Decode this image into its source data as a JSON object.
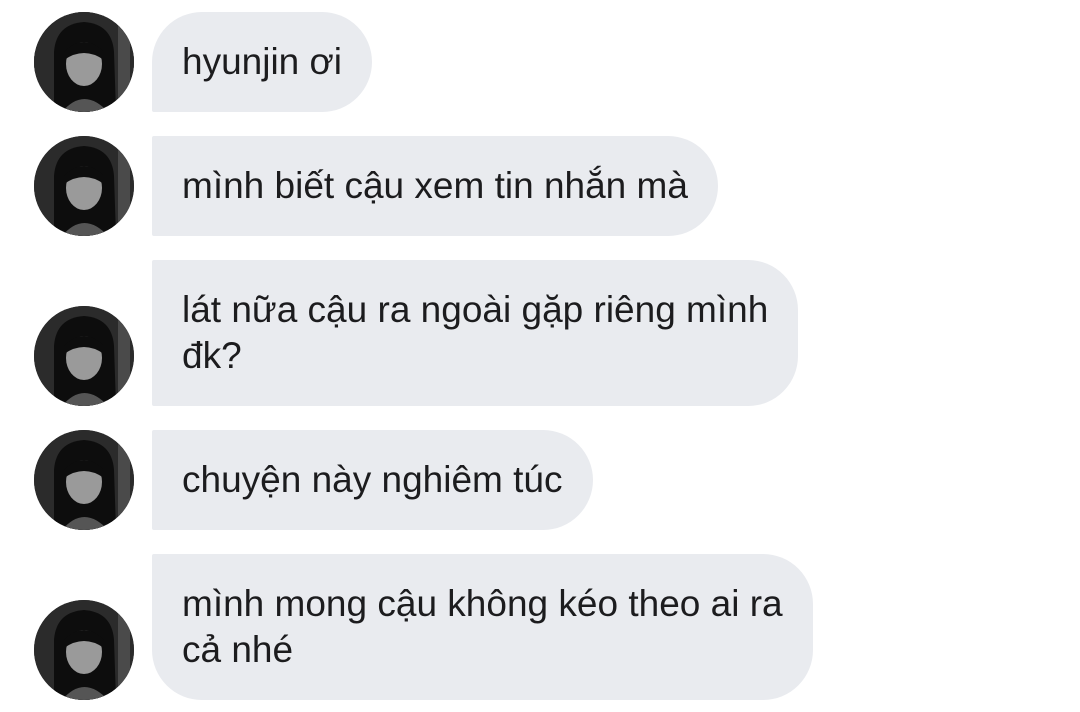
{
  "conversation": {
    "messages": [
      {
        "text": "hyunjin ơi"
      },
      {
        "text": "mình biết cậu xem tin nhắn mà"
      },
      {
        "text": "lát nữa cậu ra ngoài gặp riêng mình\nđk?"
      },
      {
        "text": "chuyện này nghiêm túc"
      },
      {
        "text": "mình mong cậu không kéo theo ai ra\ncả nhé"
      }
    ],
    "sender_avatar_icon": "avatar-girl-monochrome-icon"
  },
  "colors": {
    "bubble_background": "#e9ebef",
    "text": "#1c1c1e",
    "background": "#ffffff"
  }
}
